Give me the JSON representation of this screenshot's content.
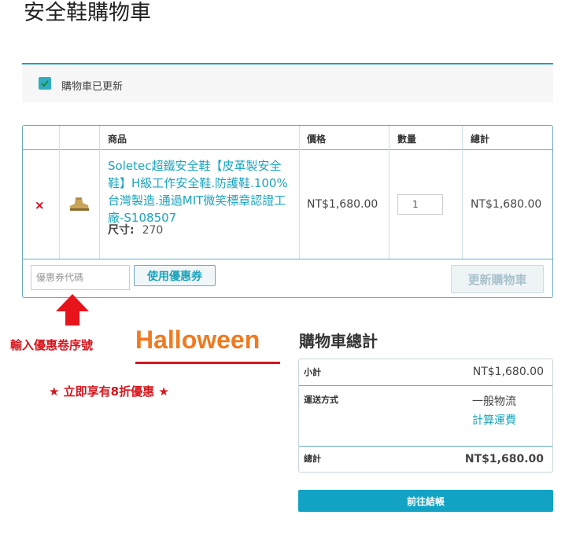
{
  "page": {
    "title": "安全鞋購物車"
  },
  "notice": {
    "message": "購物車已更新"
  },
  "cart": {
    "headers": {
      "product": "商品",
      "price": "價格",
      "quantity": "數量",
      "subtotal": "總計"
    },
    "item": {
      "remove_symbol": "×",
      "name": "Soletec超鐵安全鞋【皮革製安全鞋】H級工作安全鞋.防護鞋.100%台灣製造.通過MIT微笑標章認證工廠-S108507",
      "size_label": "尺寸:",
      "size_value": "270",
      "price": "NT$1,680.00",
      "quantity": "1",
      "subtotal": "NT$1,680.00"
    },
    "coupon_placeholder": "優惠券代碼",
    "apply_coupon_label": "使用優惠券",
    "update_cart_label": "更新購物車"
  },
  "promo": {
    "label": "輸入優惠卷序號",
    "code": "Halloween",
    "offer": "★ 立即享有8折優惠 ★"
  },
  "totals": {
    "title": "購物車總計",
    "subtotal_label": "小計",
    "subtotal_value": "NT$1,680.00",
    "shipping_label": "運送方式",
    "shipping_method": "一般物流",
    "shipping_calc": "計算運費",
    "total_label": "總計",
    "total_value": "NT$1,680.00"
  },
  "checkout": {
    "label": "前往結帳"
  },
  "colors": {
    "accent": "#1ba4bd",
    "remove": "#d0021b",
    "promo_red": "#d8141c",
    "promo_orange": "#f07a20",
    "checkout": "#12a3c4"
  }
}
